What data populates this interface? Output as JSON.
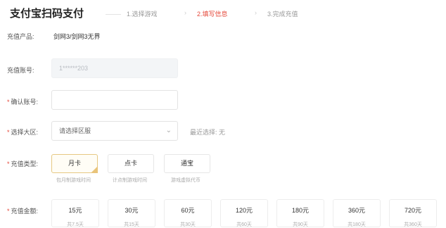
{
  "page": {
    "title": "支付宝扫码支付"
  },
  "steps": [
    {
      "label": "1.选择游戏",
      "state": "done"
    },
    {
      "label": "2.填写信息",
      "state": "active"
    },
    {
      "label": "3.完成充值",
      "state": "todo"
    }
  ],
  "form": {
    "product": {
      "label": "充值产品:",
      "value": "剑网3/剑网3无界"
    },
    "account": {
      "label": "充值账号:",
      "value": "1******203"
    },
    "confirm_account": {
      "label": "确认账号:",
      "value": "",
      "placeholder": ""
    },
    "region": {
      "label": "选择大区:",
      "placeholder": "请选择区服",
      "recent_label": "最近选择: 无"
    },
    "type": {
      "label": "充值类型:",
      "options": [
        {
          "name": "月卡",
          "desc": "包月制游戏时间",
          "selected": true
        },
        {
          "name": "点卡",
          "desc": "计点制游戏时间",
          "selected": false
        },
        {
          "name": "通宝",
          "desc": "游戏虚拟代币",
          "selected": false
        }
      ]
    },
    "amount": {
      "label": "充值金额:",
      "options": [
        {
          "value": "15元",
          "price": "共7.5天"
        },
        {
          "value": "30元",
          "price": "共15天"
        },
        {
          "value": "60元",
          "price": "共30天"
        },
        {
          "value": "120元",
          "price": "共60天"
        },
        {
          "value": "180元",
          "price": "共90天"
        },
        {
          "value": "360元",
          "price": "共180天"
        },
        {
          "value": "720元",
          "price": "共360天"
        }
      ]
    }
  },
  "colors": {
    "accent": "#e5483a",
    "selected_border": "#e6c882"
  }
}
